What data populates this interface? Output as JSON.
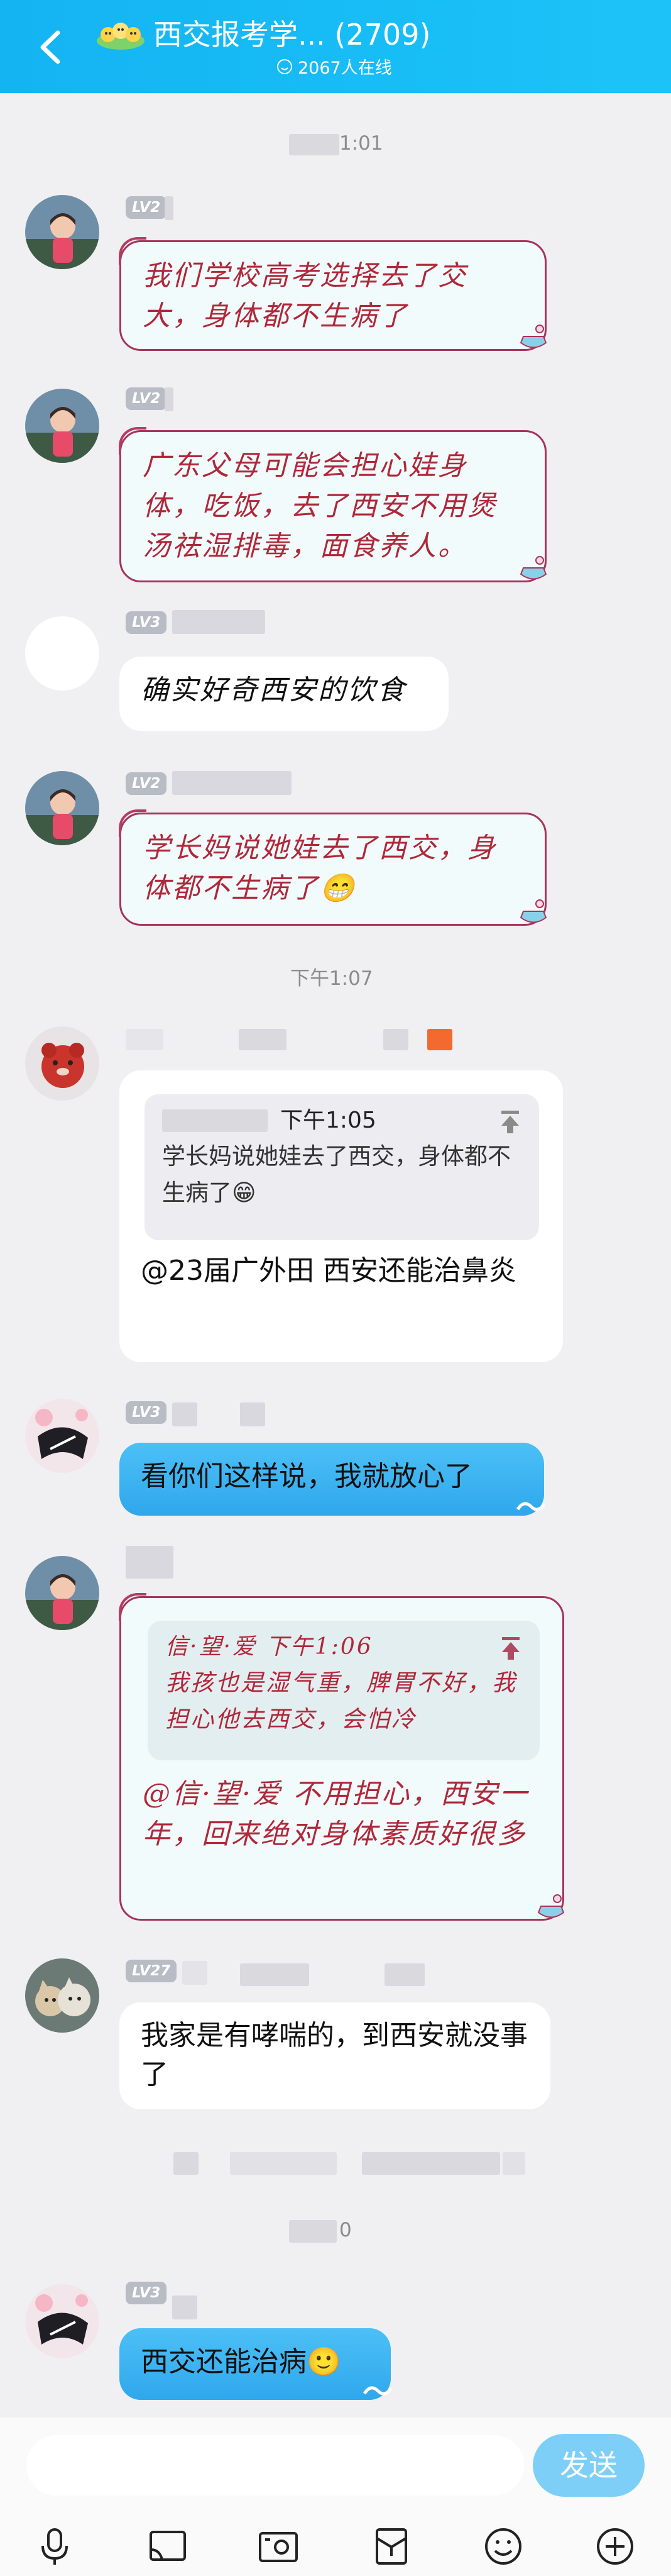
{
  "header": {
    "title": "西交报考学... (2709)",
    "online": "2067人在线"
  },
  "timestamps": {
    "t1": "1:01",
    "t2": "下午1:07",
    "t3": "0"
  },
  "messages": {
    "m1": {
      "level": "LV2",
      "text": "我们学校高考选择去了交大，身体都不生病了"
    },
    "m2": {
      "level": "LV2",
      "text": "广东父母可能会担心娃身体，吃饭，去了西安不用煲汤祛湿排毒，面食养人。"
    },
    "m3": {
      "level": "LV3",
      "text": "确实好奇西安的饮食"
    },
    "m4": {
      "level": "LV2",
      "text": "学长妈说她娃去了西交，身体都不生病了😁"
    },
    "m5": {
      "quote_time": "下午1:05",
      "quote_text": "学长妈说她娃去了西交，身体都不生病了😁",
      "text": "@23届广外田 西安还能治鼻炎"
    },
    "m6": {
      "level": "LV3",
      "text": "看你们这样说，我就放心了"
    },
    "m7": {
      "quote_author": "信·望·爱",
      "quote_time": "下午1:06",
      "quote_text": "我孩也是湿气重，脾胃不好，我担心他去西交，会怕冷",
      "text": "@信·望·爱 不用担心，西安一年，回来绝对身体素质好很多"
    },
    "m8": {
      "level": "LV27",
      "text": "我家是有哮喘的，到西安就没事了"
    },
    "m9": {
      "level": "LV3",
      "text": "西交还能治病🙂"
    }
  },
  "input": {
    "send_label": "发送",
    "placeholder": ""
  },
  "toolbar": {
    "icons": [
      "microphone-icon",
      "screen-icon",
      "photo-icon",
      "red-packet-icon",
      "emoji-icon",
      "plus-icon"
    ]
  },
  "colors": {
    "header": "#18bdf6",
    "bubble_blue": "#39b3ef",
    "deco_border": "#a7345a",
    "deco_text": "#b0283a",
    "send_button": "#7dcff7"
  }
}
